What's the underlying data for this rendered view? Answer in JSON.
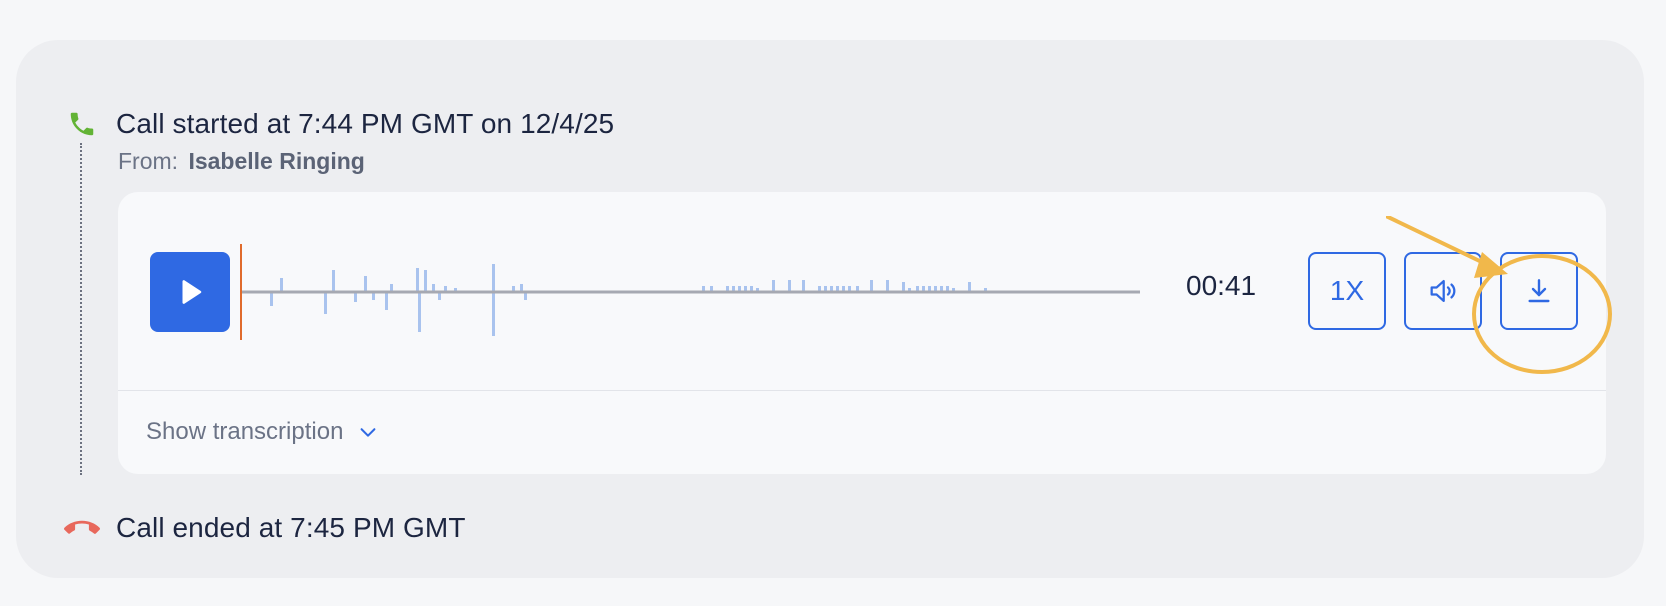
{
  "call": {
    "started_text": "Call started at 7:44 PM GMT on 12/4/25",
    "from_label": "From:",
    "from_name": "Isabelle Ringing",
    "ended_text": "Call ended at 7:45 PM GMT"
  },
  "player": {
    "duration": "00:41",
    "speed_label": "1X",
    "progress": 0,
    "transcription_label": "Show transcription"
  },
  "icons": {
    "call_start": "phone-icon",
    "call_end": "phone-hangup-icon",
    "play": "play-icon",
    "volume": "volume-icon",
    "download": "download-icon",
    "transcription": "chevron-down-icon"
  },
  "colors": {
    "accent": "#2f69e3",
    "call_start_icon": "#62b335",
    "call_end_icon": "#e8685c",
    "waveform": "#a9c3ee",
    "playhead": "#e06b2c",
    "annotation": "#f1b84b"
  }
}
